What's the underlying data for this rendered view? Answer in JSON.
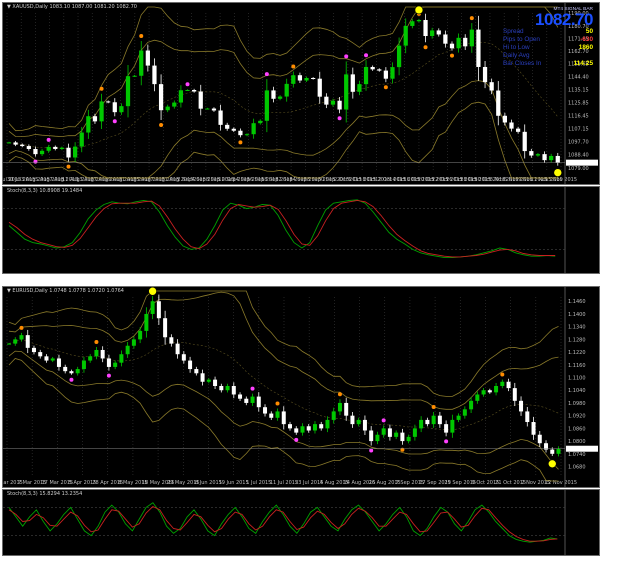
{
  "window": {
    "chart1_header": "▼ XAUUSD,Daily 1083.10 1087.00 1081.20 1082.70",
    "ind1_header": "Stoch(8,3,3) 10.8908 19.1484",
    "chart2_header": "▼ EURUSD,Daily 1.0748 1.0778 1.0720 1.0764",
    "ind2_header": "Stoch(8,3,3) 15.8294 13.2354"
  },
  "info_panel": {
    "top_label": "MT4 SIGNAL BAR",
    "price": "1082.70",
    "rows": [
      {
        "label": "Spread",
        "value": "50",
        "color": "#ffff00"
      },
      {
        "label": "Pips to Open",
        "value": "-630",
        "color": "#ff3b3b"
      },
      {
        "label": "Hi to Low",
        "value": "1860",
        "color": "#ffff00"
      },
      {
        "label": "Daily Avg",
        "value": "",
        "color": "#ffff00"
      },
      {
        "label": "Bar Closes In",
        "value": "114:25",
        "color": "#ffff00"
      }
    ]
  },
  "colors": {
    "bg": "#000000",
    "bull": "#00c800",
    "bear": "#ffffff",
    "band": "#8a7a2a",
    "stoch_main": "#00a000",
    "stoch_signal": "#c82020",
    "dot_orange": "#ff8c00",
    "dot_magenta": "#ff40ff",
    "marker_yellow": "#ffff00"
  },
  "chart_data": [
    {
      "type": "candlestick",
      "symbol": "XAUUSD,Daily",
      "ylim": [
        1076,
        1190
      ],
      "y_ticks": [
        "1190.00",
        "1180.70",
        "1171.85",
        "1162.70",
        "1153.65",
        "1144.40",
        "1135.15",
        "1125.85",
        "1116.45",
        "1107.15",
        "1097.70",
        "1088.40",
        "1079.00"
      ],
      "x_ticks": [
        "28 Jul 2015",
        "30 Jul 2015",
        "3 Aug 2015",
        "5 Aug 2015",
        "7 Aug 2015",
        "11 Aug 2015",
        "13 Aug 2015",
        "17 Aug 2015",
        "19 Aug 2015",
        "21 Aug 2015",
        "25 Aug 2015",
        "27 Aug 2015",
        "31 Aug 2015",
        "2 Sep 2015",
        "4 Sep 2015",
        "8 Sep 2015",
        "10 Sep 2015",
        "14 Sep 2015",
        "16 Sep 2015",
        "18 Sep 2015",
        "22 Sep 2015",
        "24 Sep 2015",
        "28 Sep 2015",
        "30 Sep 2015",
        "2 Oct 2015",
        "6 Oct 2015",
        "8 Oct 2015",
        "12 Oct 2015",
        "14 Oct 2015",
        "16 Oct 2015",
        "20 Oct 2015",
        "22 Oct 2015",
        "26 Oct 2015",
        "28 Oct 2015",
        "30 Oct 2015",
        "3 Nov 2015",
        "5 Nov 2015",
        "9 Nov 2015",
        "11 Nov 2015",
        "13 Nov 2015"
      ],
      "close": [
        1097.2,
        1095.6,
        1094.6,
        1092.5,
        1088.8,
        1091.2,
        1094.0,
        1092.5,
        1093.4,
        1086.4,
        1094.2,
        1104.3,
        1116.0,
        1112.3,
        1126.6,
        1126.0,
        1118.9,
        1123.2,
        1144.7,
        1145.0,
        1163.1,
        1152.3,
        1139.0,
        1120.3,
        1122.9,
        1125.8,
        1134.6,
        1134.8,
        1133.7,
        1121.4,
        1121.5,
        1120.1,
        1109.8,
        1107.0,
        1105.6,
        1102.4,
        1103.1,
        1111.0,
        1112.7,
        1134.5,
        1128.5,
        1130.1,
        1139.2,
        1145.4,
        1141.6,
        1143.4,
        1142.9,
        1130.0,
        1124.3,
        1127.1,
        1120.8,
        1146.0,
        1133.5,
        1139.0,
        1151.3,
        1149.6,
        1148.7,
        1142.9,
        1151.2,
        1166.6,
        1180.7,
        1184.1,
        1185.0,
        1173.5,
        1177.5,
        1174.6,
        1168.0,
        1164.7,
        1172.2,
        1166.1,
        1178.1,
        1151.3,
        1140.4,
        1134.4,
        1116.3,
        1111.5,
        1107.1,
        1104.8,
        1091.0,
        1087.8,
        1088.8,
        1084.5,
        1087.5,
        1082.7
      ]
    },
    {
      "type": "line",
      "name": "Stoch(8,3,3)",
      "ylim": [
        0,
        100
      ],
      "series": [
        {
          "values": [
            55,
            45,
            35,
            30,
            28,
            25,
            22,
            24,
            30,
            45,
            65,
            78,
            86,
            90,
            88,
            87,
            90,
            92,
            90,
            75,
            55,
            38,
            25,
            20,
            22,
            35,
            55,
            78,
            88,
            85,
            80,
            82,
            86,
            85,
            70,
            48,
            30,
            22,
            30,
            55,
            78,
            88,
            90,
            92,
            93,
            88,
            75,
            60,
            45,
            35,
            28,
            20,
            15,
            12,
            10,
            8,
            8,
            9,
            10,
            12,
            15,
            18,
            22,
            20,
            15,
            12,
            10,
            10,
            11,
            10
          ]
        },
        {
          "values": [
            60,
            52,
            42,
            35,
            30,
            27,
            24,
            23,
            26,
            36,
            52,
            68,
            80,
            87,
            88,
            88,
            88,
            90,
            91,
            84,
            68,
            50,
            35,
            24,
            21,
            28,
            42,
            63,
            80,
            86,
            84,
            82,
            83,
            85,
            79,
            62,
            42,
            28,
            26,
            40,
            62,
            80,
            88,
            90,
            92,
            90,
            83,
            70,
            55,
            42,
            33,
            25,
            18,
            14,
            12,
            10,
            9,
            9,
            10,
            11,
            13,
            16,
            19,
            20,
            18,
            14,
            12,
            11,
            11,
            11
          ]
        }
      ]
    },
    {
      "type": "candlestick",
      "symbol": "EURUSD,Daily",
      "ylim": [
        1.064,
        1.148
      ],
      "y_ticks": [
        "1.1460",
        "1.1400",
        "1.1340",
        "1.1280",
        "1.1220",
        "1.1160",
        "1.1100",
        "1.1040",
        "1.0980",
        "1.0920",
        "1.0860",
        "1.0800",
        "1.0740",
        "1.0680"
      ],
      "x_ticks": [
        "26 Mar 2015",
        "7 Mar 2015",
        "17 Mar 2015",
        "5 Apr 2015",
        "28 Apr 2015",
        "8 May 2015",
        "18 May 2015",
        "29 May 2015",
        "8 Jun 2015",
        "19 Jun 2015",
        "1 Jul 2015",
        "11 Jul 2015",
        "23 Jul 2015",
        "4 Aug 2015",
        "14 Aug 2015",
        "26 Aug 2015",
        "7 Sep 2015",
        "17 Sep 2015",
        "29 Sep 2015",
        "9 Oct 2015",
        "21 Oct 2015",
        "2 Nov 2015",
        "12 Nov 2015"
      ],
      "close": [
        1.126,
        1.128,
        1.13,
        1.124,
        1.122,
        1.12,
        1.118,
        1.119,
        1.115,
        1.113,
        1.112,
        1.114,
        1.118,
        1.12,
        1.123,
        1.119,
        1.115,
        1.117,
        1.121,
        1.125,
        1.128,
        1.132,
        1.14,
        1.146,
        1.138,
        1.129,
        1.126,
        1.121,
        1.118,
        1.114,
        1.112,
        1.108,
        1.109,
        1.106,
        1.104,
        1.106,
        1.102,
        1.1,
        1.098,
        1.101,
        1.096,
        1.093,
        1.091,
        1.094,
        1.088,
        1.086,
        1.084,
        1.087,
        1.085,
        1.088,
        1.086,
        1.09,
        1.094,
        1.098,
        1.092,
        1.088,
        1.09,
        1.085,
        1.08,
        1.083,
        1.086,
        1.082,
        1.084,
        1.08,
        1.082,
        1.086,
        1.09,
        1.088,
        1.092,
        1.088,
        1.084,
        1.09,
        1.092,
        1.095,
        1.099,
        1.102,
        1.104,
        1.103,
        1.106,
        1.108,
        1.105,
        1.099,
        1.094,
        1.089,
        1.083,
        1.079,
        1.076,
        1.074,
        1.0764
      ]
    },
    {
      "type": "line",
      "name": "Stoch(8,3,3)",
      "ylim": [
        0,
        100
      ],
      "series": [
        {
          "values": [
            80,
            60,
            40,
            60,
            75,
            50,
            30,
            45,
            65,
            80,
            55,
            30,
            20,
            40,
            70,
            85,
            70,
            45,
            30,
            55,
            80,
            90,
            70,
            40,
            25,
            35,
            60,
            75,
            55,
            30,
            20,
            45,
            65,
            80,
            60,
            35,
            25,
            50,
            70,
            85,
            65,
            40,
            25,
            45,
            70,
            80,
            60,
            40,
            30,
            55,
            75,
            85,
            70,
            50,
            30,
            45,
            65,
            80,
            60,
            30,
            20,
            35,
            60,
            80,
            70,
            45,
            30,
            50,
            75,
            85,
            70,
            50,
            35,
            20,
            12,
            8,
            6,
            8,
            10,
            15,
            13
          ]
        },
        {
          "values": [
            75,
            65,
            50,
            52,
            65,
            58,
            42,
            40,
            55,
            70,
            62,
            42,
            28,
            32,
            55,
            75,
            72,
            55,
            38,
            45,
            68,
            82,
            75,
            52,
            35,
            32,
            48,
            65,
            60,
            42,
            28,
            35,
            55,
            70,
            65,
            45,
            32,
            40,
            60,
            75,
            70,
            50,
            33,
            38,
            58,
            72,
            65,
            48,
            35,
            45,
            65,
            78,
            72,
            58,
            40,
            40,
            55,
            70,
            65,
            45,
            28,
            30,
            48,
            68,
            70,
            55,
            38,
            42,
            62,
            78,
            75,
            58,
            42,
            28,
            18,
            12,
            8,
            8,
            9,
            12,
            13
          ]
        }
      ]
    }
  ]
}
